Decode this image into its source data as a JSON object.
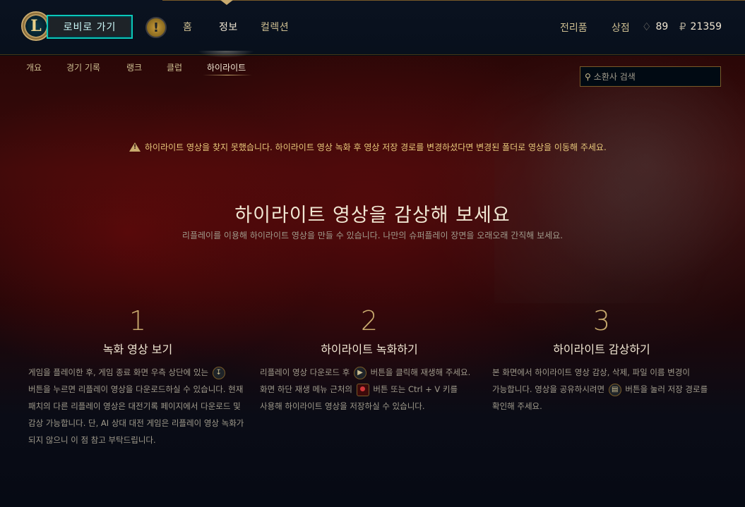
{
  "topbar": {
    "logo_letter": "L",
    "lobby_button": "로비로 가기",
    "alert_icon": "!",
    "nav": [
      {
        "label": "홈"
      },
      {
        "label": "정보"
      },
      {
        "label": "컬렉션"
      }
    ],
    "right_nav": [
      {
        "label": "전리품"
      },
      {
        "label": "상점"
      }
    ],
    "currency": {
      "blue_essence_icon": "blue-essence-icon",
      "blue_essence_value": "89",
      "rp_icon": "riot-points-icon",
      "rp_value": "21359"
    }
  },
  "subnav": {
    "tabs": [
      {
        "label": "개요"
      },
      {
        "label": "경기 기록"
      },
      {
        "label": "랭크"
      },
      {
        "label": "클럽"
      },
      {
        "label": "하이라이트"
      }
    ],
    "active": "하이라이트",
    "search_placeholder": "소환사 검색"
  },
  "main": {
    "warning": "하이라이트 영상을 찾지 못했습니다. 하이라이트 영상 녹화 후 영상 저장 경로를 변경하셨다면 변경된 폴더로 영상을 이동해 주세요.",
    "title": "하이라이트 영상을 감상해 보세요",
    "subtitle": "리플레이를 이용해 하이라이트 영상을 만들 수 있습니다. 나만의 슈퍼플레이 장면을 오래오래 간직해 보세요.",
    "steps": [
      {
        "number": "1",
        "title": "녹화 영상 보기",
        "body_a": "게임을 플레이한 후, 게임 종료 화면 우측 상단에 있는",
        "body_b": "버튼을 누르면 리플레이 영상을 다운로드하실 수 있습니다. 현재 패치의 다른 리플레이 영상은 대전기록 페이지에서 다운로드 및 감상 가능합니다. 단, AI 상대 대전 게임은 리플레이 영상 녹화가 되지 않으니 이 점 참고 부탁드립니다."
      },
      {
        "number": "2",
        "title": "하이라이트 녹화하기",
        "body_a": "리플레이 영상 다운로드 후",
        "body_b": "버튼을 클릭해 재생해 주세요. 화면 하단 재생 메뉴 근처의",
        "body_c": "버튼 또는 Ctrl + V 키를 사용해 하이라이트 영상을 저장하실 수 있습니다."
      },
      {
        "number": "3",
        "title": "하이라이트 감상하기",
        "body_a": "본 화면에서 하이라이트 영상 감상, 삭제, 파일 이름 변경이 가능합니다. 영상을 공유하시려면",
        "body_b": "버튼을 눌러 저장 경로를 확인해 주세요."
      }
    ]
  },
  "colors": {
    "gold": "#c8aa6e",
    "teal": "#0ac8b9",
    "text": "#cdbe91",
    "warning": "#e7c87a"
  }
}
